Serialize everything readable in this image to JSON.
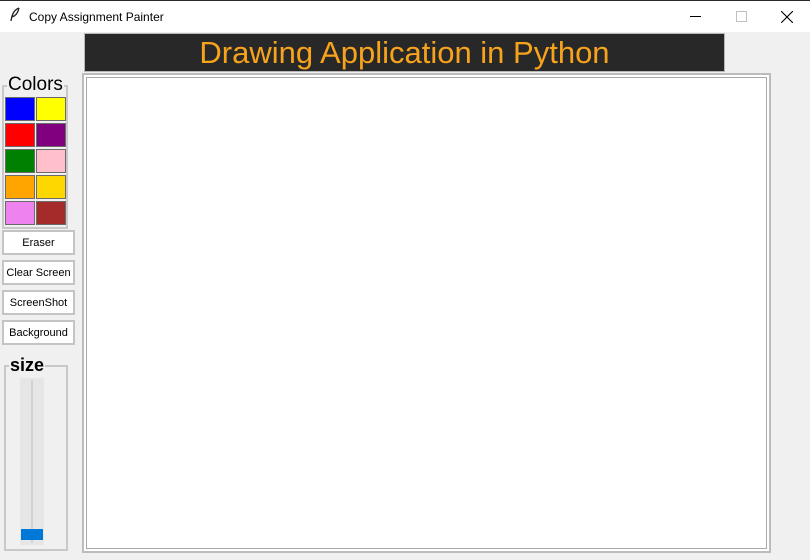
{
  "window": {
    "title": "Copy Assignment Painter",
    "icon": "feather-icon"
  },
  "window_controls": {
    "minimize": "—",
    "maximize": "☐",
    "close": "✕"
  },
  "header": {
    "title": "Drawing Application in Python",
    "title_color": "#f7a31b",
    "background": "#282828"
  },
  "colors_panel": {
    "label": "Colors",
    "swatches": [
      {
        "name": "blue",
        "color": "#0000ff"
      },
      {
        "name": "yellow",
        "color": "#ffff00"
      },
      {
        "name": "red",
        "color": "#ff0000"
      },
      {
        "name": "purple",
        "color": "#800080"
      },
      {
        "name": "green",
        "color": "#008000"
      },
      {
        "name": "pink",
        "color": "#ffc0cb"
      },
      {
        "name": "orange",
        "color": "#ffa500"
      },
      {
        "name": "gold",
        "color": "#ffd700"
      },
      {
        "name": "violet",
        "color": "#ee82ee"
      },
      {
        "name": "brown",
        "color": "#a52a2a"
      }
    ]
  },
  "buttons": {
    "eraser": "Eraser",
    "clear_screen": "Clear Screen",
    "screenshot": "ScreenShot",
    "background": "Background"
  },
  "size_panel": {
    "label": "size",
    "slider_level": 1.0,
    "accent": "#0078d7"
  }
}
